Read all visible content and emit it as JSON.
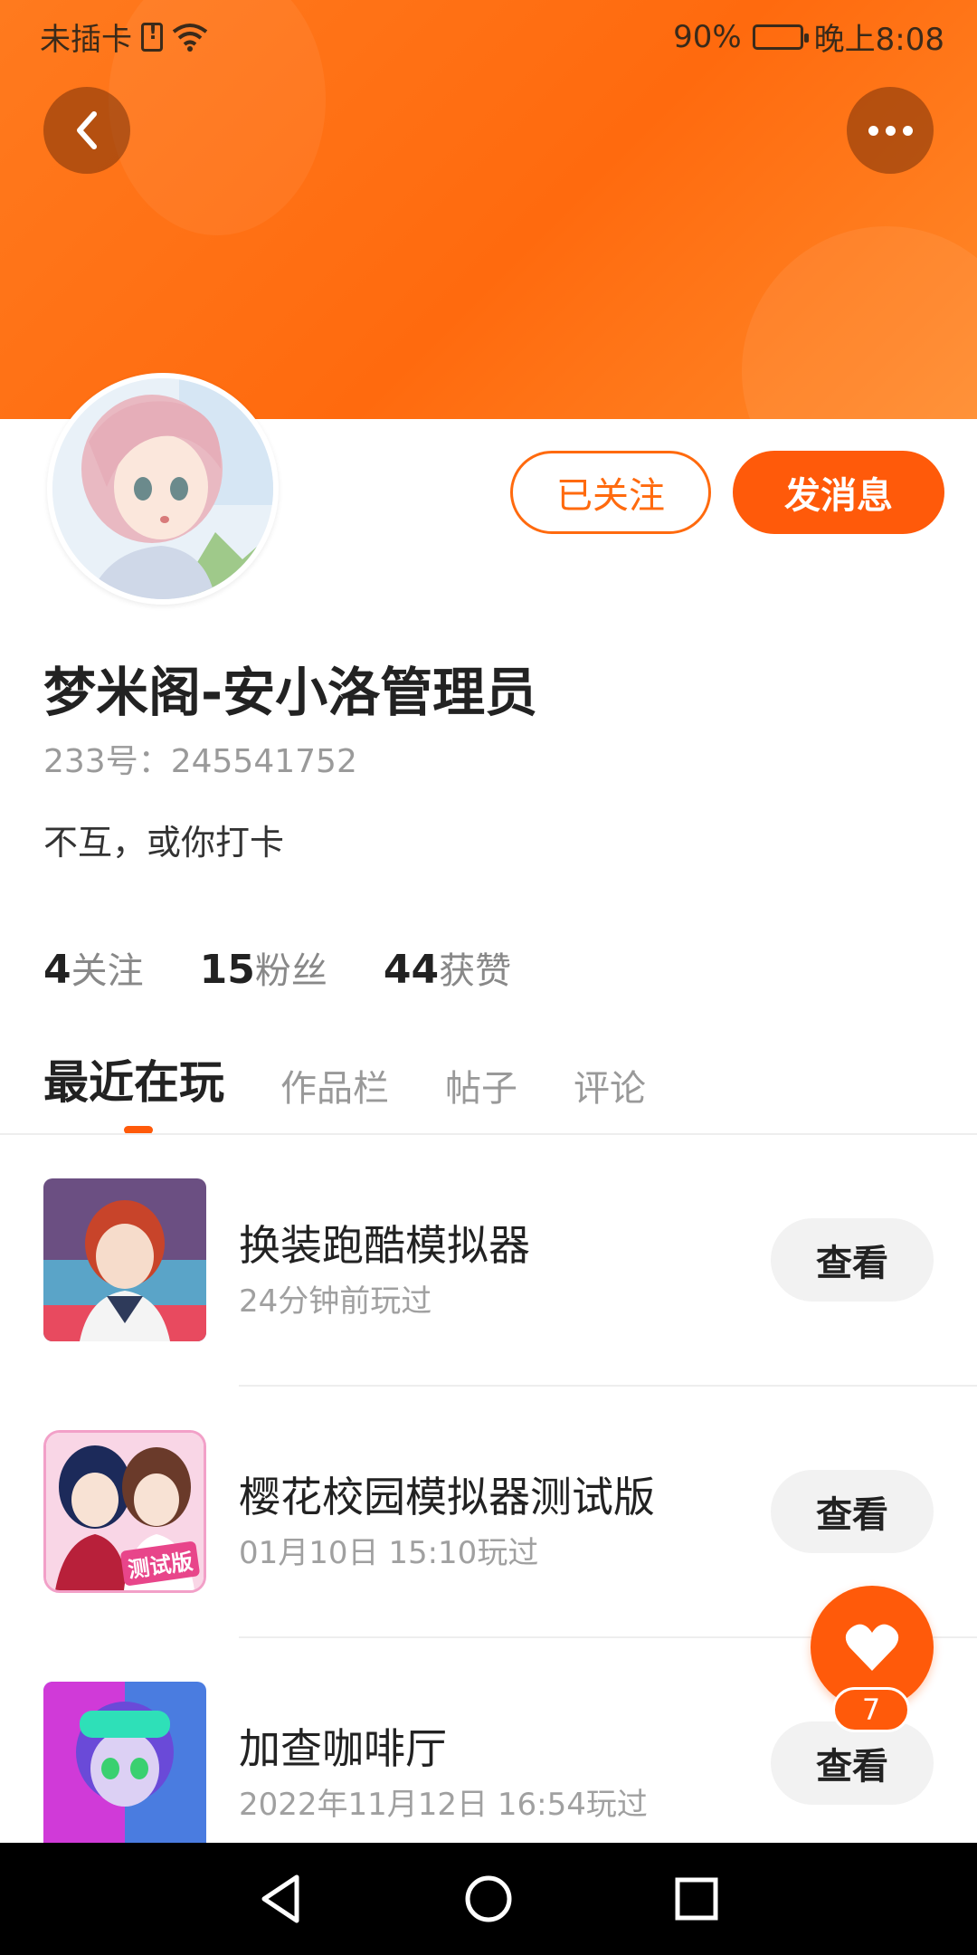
{
  "status_bar": {
    "carrier": "未插卡",
    "battery": "90%",
    "battery_level": 0.9,
    "time": "晚上8:08"
  },
  "header": {
    "back_icon": "chevron-left-icon",
    "more_icon": "more-dots-icon",
    "accent_color": "#ff6a0e"
  },
  "profile": {
    "follow_button": "已关注",
    "message_button": "发消息",
    "name": "梦米阁-安小洛管理员",
    "id_line": "233号：245541752",
    "bio": "不互，或你打卡"
  },
  "stats": [
    {
      "num": "4",
      "label": "关注"
    },
    {
      "num": "15",
      "label": "粉丝"
    },
    {
      "num": "44",
      "label": "获赞"
    }
  ],
  "tabs": [
    {
      "label": "最近在玩",
      "active": true
    },
    {
      "label": "作品栏",
      "active": false
    },
    {
      "label": "帖子",
      "active": false
    },
    {
      "label": "评论",
      "active": false
    }
  ],
  "games": [
    {
      "name": "换装跑酷模拟器",
      "time": "24分钟前玩过",
      "button": "查看"
    },
    {
      "name": "樱花校园模拟器测试版",
      "time": "01月10日 15:10玩过",
      "button": "查看",
      "thumb_badge": "测试版"
    },
    {
      "name": "加查咖啡厅",
      "time": "2022年11月12日 16:54玩过",
      "button": "查看"
    }
  ],
  "like_fab": {
    "icon": "heart-icon",
    "count": "7"
  },
  "navbar": {
    "back": "triangle-back-icon",
    "home": "circle-home-icon",
    "recents": "square-recents-icon"
  }
}
